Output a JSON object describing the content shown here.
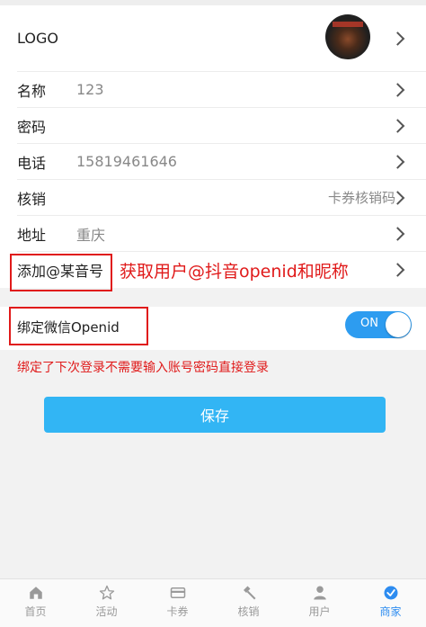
{
  "settings": {
    "logo_label": "LOGO",
    "name_label": "名称",
    "name_value": "123",
    "password_label": "密码",
    "phone_label": "电话",
    "phone_value": "15819461646",
    "verify_label": "核销",
    "verify_value": "卡券核销码",
    "address_label": "地址",
    "address_value": "重庆",
    "douyin_label": "添加@某音号",
    "douyin_hint": "获取用户@抖音openid和昵称",
    "wechat_label": "绑定微信Openid",
    "toggle_text": "ON",
    "bind_hint": "绑定了下次登录不需要输入账号密码直接登录",
    "save_label": "保存"
  },
  "tabs": [
    {
      "label": "首页",
      "icon": "home-icon"
    },
    {
      "label": "活动",
      "icon": "star-icon"
    },
    {
      "label": "卡券",
      "icon": "card-icon"
    },
    {
      "label": "核销",
      "icon": "hammer-icon"
    },
    {
      "label": "用户",
      "icon": "user-icon"
    },
    {
      "label": "商家",
      "icon": "check-circle-icon"
    }
  ],
  "colors": {
    "accent": "#2d8cf0",
    "save_button": "#32b5f4",
    "annotation": "#e01a1a"
  }
}
